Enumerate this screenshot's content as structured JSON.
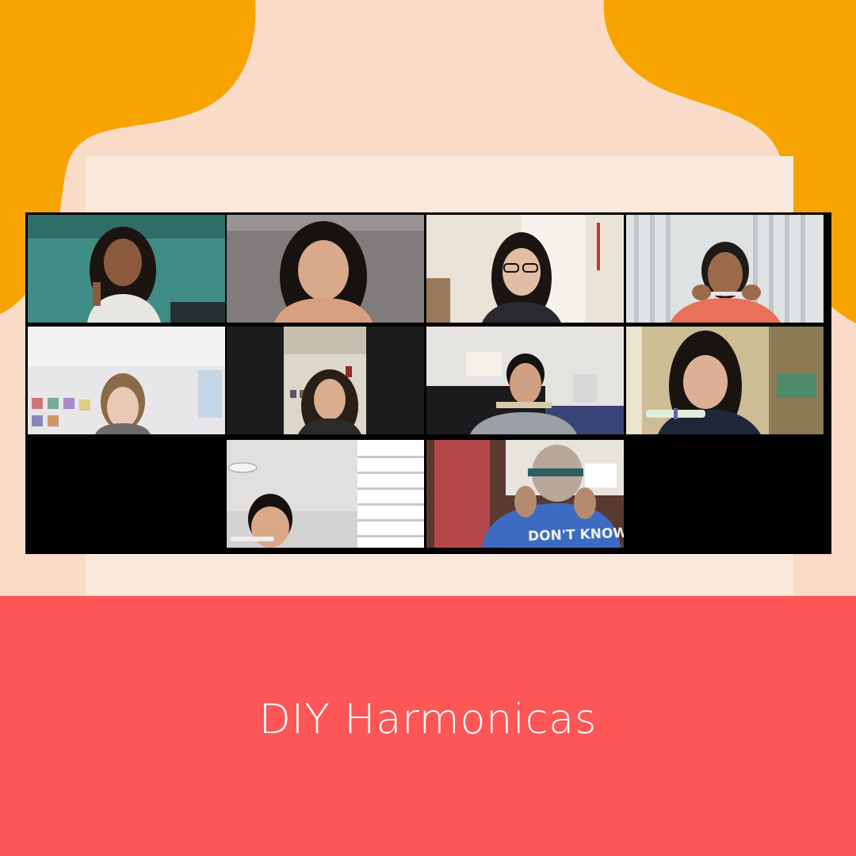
{
  "caption": "DIY Harmonicas",
  "colors": {
    "background": "#f9dbc7",
    "accent_orange": "#f7a400",
    "panel": "#f8e9dc",
    "footer_red": "#fd5656",
    "caption_text": "#ffffff",
    "gallery_bg": "#000000",
    "active_speaker_border": "#f2f27a"
  },
  "gallery": {
    "layout": "speaker grid",
    "participants": [
      {
        "id": "p1",
        "shirt_text": "",
        "scene": "teal-wall-room",
        "active": false
      },
      {
        "id": "p2",
        "shirt_text": "",
        "scene": "gray-room",
        "active": true
      },
      {
        "id": "p3",
        "shirt_text": "",
        "scene": "door-room-glasses",
        "active": false
      },
      {
        "id": "p4",
        "shirt_text": "",
        "scene": "window-blinds",
        "active": false
      },
      {
        "id": "p5",
        "shirt_text": "",
        "scene": "bedroom-posters",
        "active": false
      },
      {
        "id": "p6",
        "shirt_text": "",
        "scene": "narrow-portrait",
        "active": false
      },
      {
        "id": "p7",
        "shirt_text": "",
        "scene": "piano-room",
        "active": false
      },
      {
        "id": "p8",
        "shirt_text": "",
        "scene": "kitchen-shelves",
        "active": false
      },
      {
        "id": "p9",
        "shirt_text": "",
        "scene": "white-ceiling-blinds",
        "active": false
      },
      {
        "id": "p10",
        "shirt_text": "DON'T KNOW W",
        "scene": "red-curtain-blue-shirt",
        "active": false
      }
    ]
  }
}
